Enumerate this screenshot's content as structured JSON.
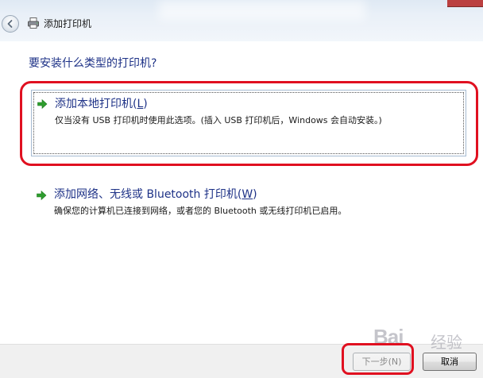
{
  "window": {
    "title": "添加打印机"
  },
  "heading": "要安装什么类型的打印机?",
  "options": [
    {
      "title": "添加本地打印机(",
      "access_key": "L",
      "title_end": ")",
      "description": "仅当没有 USB 打印机时使用此选项。(插入 USB 打印机后，Windows 会自动安装。)",
      "icon": "green-arrow-icon",
      "selected": true
    },
    {
      "title": "添加网络、无线或 Bluetooth 打印机(",
      "access_key": "W",
      "title_end": ")",
      "description": "确保您的计算机已连接到网络，或者您的 Bluetooth 或无线打印机已启用。",
      "icon": "green-arrow-icon",
      "selected": false
    }
  ],
  "buttons": {
    "next_label": "下一步(N)",
    "next_enabled": false,
    "cancel_label": "取消"
  },
  "watermark": {
    "logo": "Bai",
    "suffix": "经验"
  },
  "colors": {
    "heading": "#1e3287",
    "annotation": "#e01020",
    "arrow": "#2e9d2e"
  }
}
